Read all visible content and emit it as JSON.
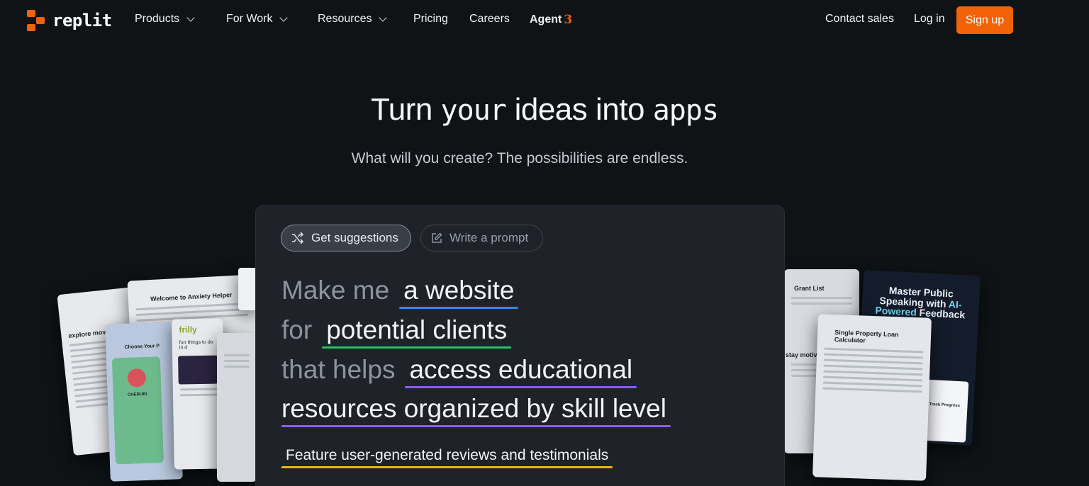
{
  "nav": {
    "logo_text": "replit",
    "items": [
      {
        "label": "Products"
      },
      {
        "label": "For Work"
      },
      {
        "label": "Resources"
      },
      {
        "label": "Pricing"
      },
      {
        "label": "Careers"
      }
    ],
    "agent_label": "Agent",
    "agent_version": "3",
    "contact_sales": "Contact sales",
    "log_in": "Log in",
    "sign_up": "Sign up"
  },
  "hero": {
    "title_a": "Turn",
    "title_b": "your",
    "title_c": "ideas",
    "title_d": "into",
    "title_e": "apps",
    "subtitle": "What will you create? The possibilities are endless."
  },
  "prompt": {
    "tab_suggestions": "Get suggestions",
    "tab_write": "Write a prompt",
    "line1_lead": "Make me",
    "line1_value": "a website",
    "line2_lead": "for",
    "line2_value": "potential clients",
    "line3_lead": "that helps",
    "line3_value": "access educational",
    "line4_value": "resources organized by skill level",
    "feature": "Feature user-generated reviews and testimonials"
  },
  "cards": {
    "anxiety_title": "Welcome to Anxiety Helper",
    "movies_title": "explore movies",
    "frilly_title": "frilly",
    "frilly_text": "fun things to do in d",
    "cherubi_label": "CHERUBI",
    "choose_text": "Choose Your P",
    "grant_title": "Grant List",
    "stay_motivated": "stay motivated",
    "loan_title": "Single Property Loan Calculator",
    "speaking_title_a": "Master Public Speaking with",
    "speaking_title_b": "AI-Powered",
    "speaking_title_c": "Feedback",
    "track_progress": "Track Progress"
  },
  "colors": {
    "accent": "#f26207",
    "underline_blue": "#3b82f6",
    "underline_green": "#22c55e",
    "underline_purple": "#8b5cf6",
    "underline_yellow": "#e7b81d"
  }
}
